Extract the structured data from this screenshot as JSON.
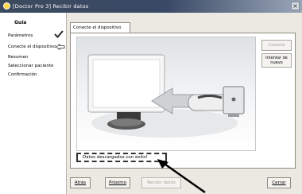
{
  "window": {
    "title": "[Doctor Pro 3] Recibir datos",
    "close_glyph": "×"
  },
  "sidebar": {
    "heading": "Guía",
    "items": [
      {
        "label": "Parámetros",
        "state": "done"
      },
      {
        "label": "Conecte el dispositivo",
        "state": "current"
      },
      {
        "label": "Resumen",
        "state": "pending"
      },
      {
        "label": "Seleccionar paciente",
        "state": "pending"
      },
      {
        "label": "Confirmación",
        "state": "pending"
      }
    ]
  },
  "tab": {
    "label": "Conecte el dispositivo"
  },
  "side_buttons": {
    "connect": "Conecte",
    "retry": "Intentar de nuevo"
  },
  "status": {
    "message": "Datos descargados con éxito!"
  },
  "footer": {
    "back": "Atrás",
    "next": "Próximo",
    "disabled_button": "Recibir datos",
    "close": "Cerrar"
  },
  "icons": [
    "app-icon",
    "check-icon",
    "arrow-left-icon",
    "close-icon"
  ],
  "colors": {
    "titlebar": "#3c4a5e",
    "check": "#2a2a2a"
  }
}
